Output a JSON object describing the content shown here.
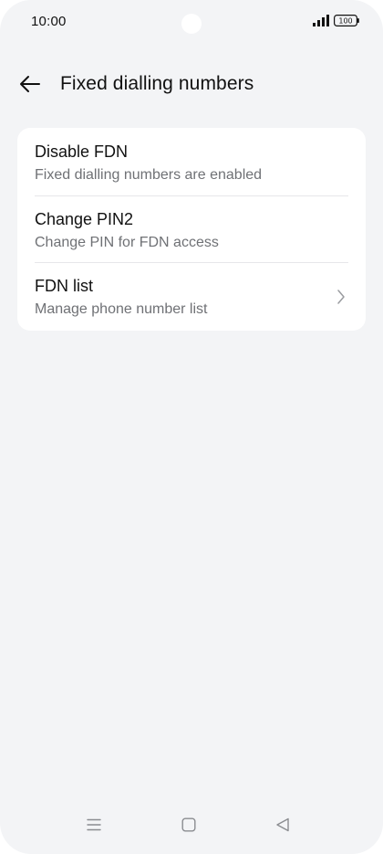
{
  "status_bar": {
    "time": "10:00",
    "battery": "100"
  },
  "header": {
    "title": "Fixed dialling numbers"
  },
  "items": [
    {
      "title": "Disable FDN",
      "subtitle": "Fixed dialling numbers are enabled"
    },
    {
      "title": "Change PIN2",
      "subtitle": "Change PIN for FDN access"
    },
    {
      "title": "FDN list",
      "subtitle": "Manage phone number list"
    }
  ],
  "icons": {
    "back": "arrow-left-icon",
    "chevron": "chevron-right-icon",
    "menu": "menu-icon",
    "home": "home-icon",
    "back_nav": "back-triangle-icon"
  },
  "colors": {
    "background": "#f3f4f6",
    "card": "#ffffff",
    "text_primary": "#111111",
    "text_secondary": "#6f7175"
  }
}
